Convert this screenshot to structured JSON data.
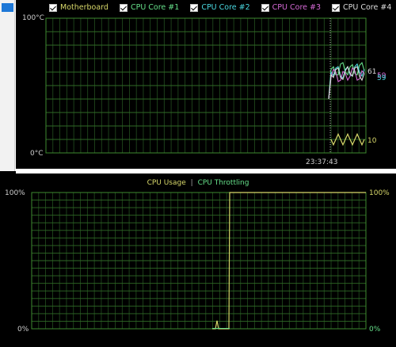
{
  "sidebar": {
    "accent": "#1e78d7"
  },
  "temperature_chart": {
    "legend": [
      {
        "label": "Motherboard",
        "color": "#d8d86a"
      },
      {
        "label": "CPU Core #1",
        "color": "#66e08a"
      },
      {
        "label": "CPU Core #2",
        "color": "#4ad8e0"
      },
      {
        "label": "CPU Core #3",
        "color": "#d66ad6"
      },
      {
        "label": "CPU Core #4",
        "color": "#dddddd"
      }
    ],
    "y_max_label": "100°C",
    "y_min_label": "0°C",
    "time_label": "23:37:43",
    "value_labels": {
      "v61": "61",
      "v59a": "59",
      "v59b": "59",
      "v10": "10"
    }
  },
  "usage_chart": {
    "legend_usage": "CPU Usage",
    "legend_separator": "|",
    "legend_throttling": "CPU Throttling",
    "usage_color": "#d8d86a",
    "throttling_color": "#66e08a",
    "left_max": "100%",
    "left_min": "0%",
    "right_max": "100%",
    "right_min": "0%"
  },
  "chart_data": [
    {
      "type": "line",
      "ylim": [
        0,
        100
      ],
      "series": [
        {
          "name": "Motherboard",
          "values": [
            10,
            10,
            10,
            10,
            10,
            10,
            10,
            10
          ]
        },
        {
          "name": "CPU Core #1",
          "values": [
            62,
            58,
            66,
            60,
            64,
            59,
            65,
            61
          ]
        },
        {
          "name": "CPU Core #2",
          "values": [
            60,
            63,
            57,
            62,
            58,
            64,
            60,
            62
          ]
        },
        {
          "name": "CPU Core #3",
          "values": [
            56,
            60,
            54,
            59,
            57,
            61,
            55,
            59
          ]
        },
        {
          "name": "CPU Core #4",
          "values": [
            58,
            62,
            56,
            61,
            59,
            63,
            57,
            59
          ]
        }
      ]
    },
    {
      "type": "line",
      "ylim": [
        0,
        100
      ],
      "series": [
        {
          "name": "CPU Usage",
          "values": [
            0,
            0,
            6,
            0,
            100,
            100,
            100,
            100
          ]
        },
        {
          "name": "CPU Throttling",
          "values": [
            0,
            0,
            0,
            0,
            0,
            0,
            0,
            0
          ]
        }
      ]
    }
  ]
}
